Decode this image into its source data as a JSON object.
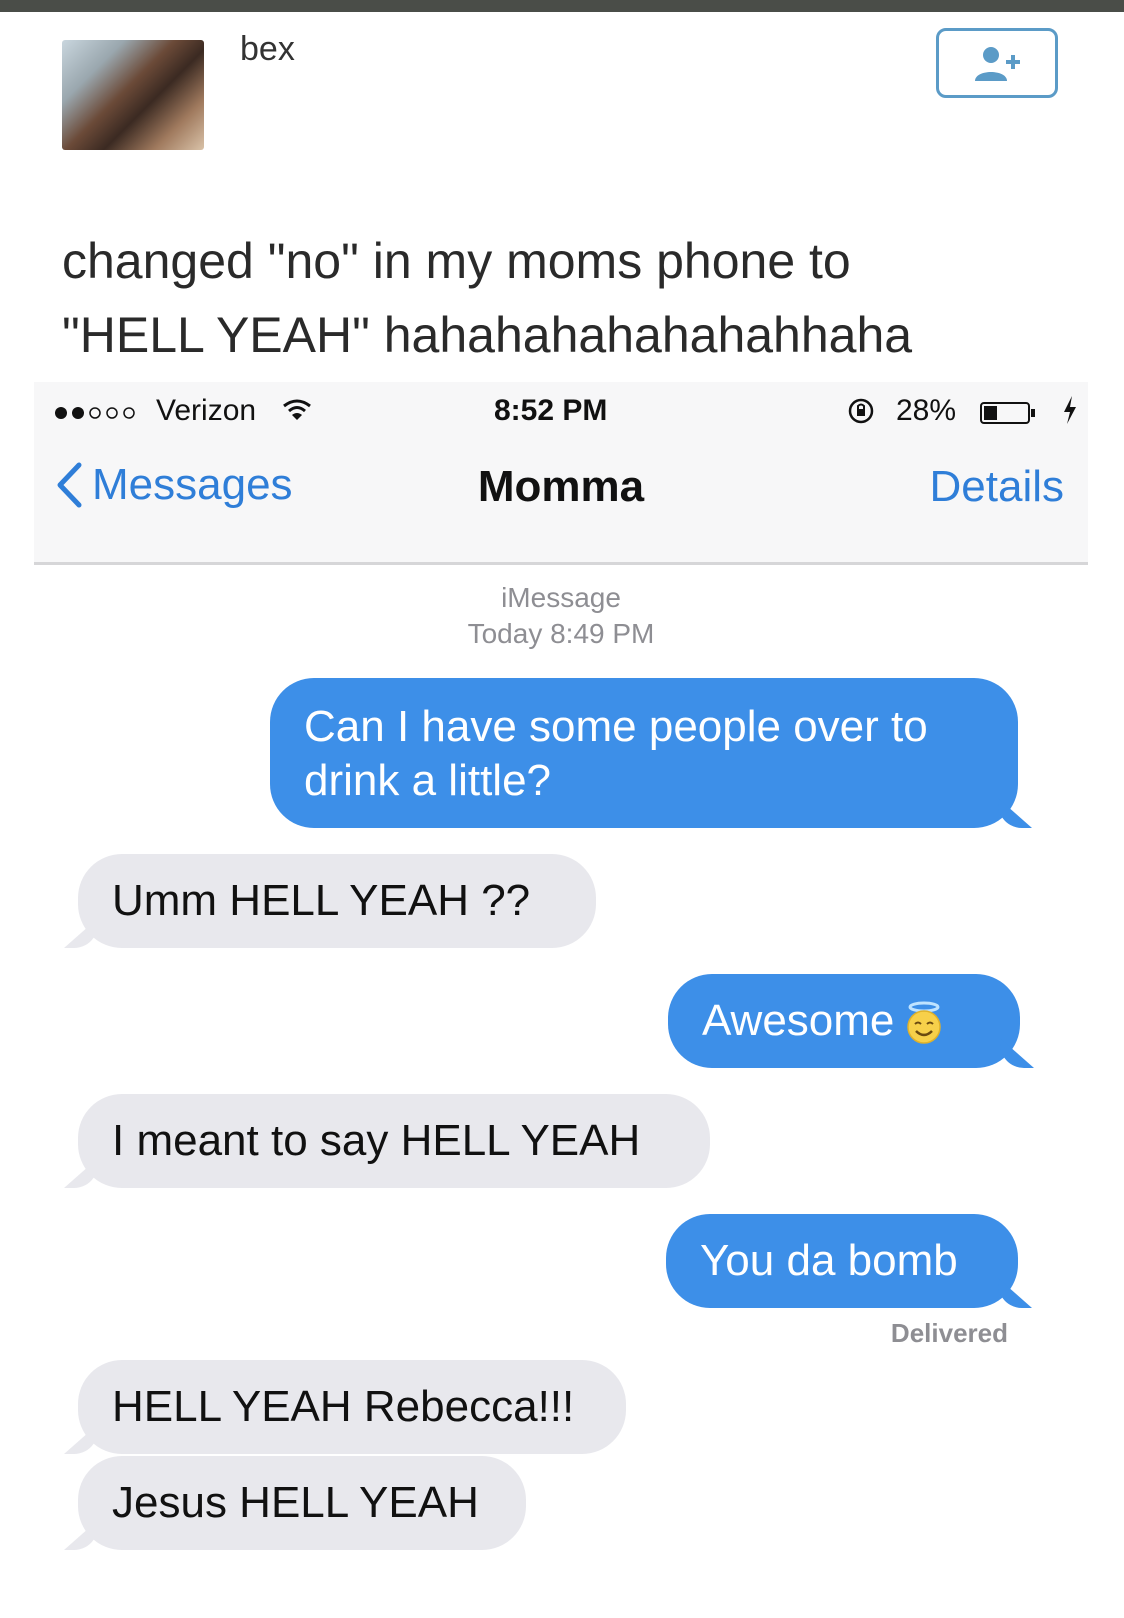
{
  "tweet": {
    "username": "bex",
    "text_line1": "changed \"no\" in my moms phone to",
    "text_line2": "\"HELL YEAH\" hahahahahahahahhaha"
  },
  "status_bar": {
    "signal": "●●○○○",
    "carrier": "Verizon",
    "time": "8:52 PM",
    "battery": "28%"
  },
  "nav": {
    "back_label": "Messages",
    "title": "Momma",
    "details_label": "Details"
  },
  "conversation": {
    "service": "iMessage",
    "timestamp": "Today 8:49 PM",
    "messages": [
      {
        "from": "me",
        "text": "Can I have some people over to drink a little?"
      },
      {
        "from": "them",
        "text": "Umm HELL YEAH ??"
      },
      {
        "from": "me",
        "text": "Awesome"
      },
      {
        "from": "them",
        "text": "I meant to say HELL YEAH"
      },
      {
        "from": "me",
        "text": "You da bomb"
      },
      {
        "from": "them",
        "text": "HELL YEAH Rebecca!!!"
      },
      {
        "from": "them",
        "text": "Jesus HELL YEAH"
      }
    ],
    "delivered_label": "Delivered"
  },
  "colors": {
    "sent_bubble": "#3d8fe8",
    "received_bubble": "#e8e8ed",
    "link_blue": "#2f7ed8"
  },
  "icons": [
    "follow-user-icon",
    "wifi-icon",
    "lock-rotation-icon",
    "battery-icon",
    "charging-bolt-icon",
    "back-chevron-icon",
    "halo-smiley-emoji"
  ]
}
